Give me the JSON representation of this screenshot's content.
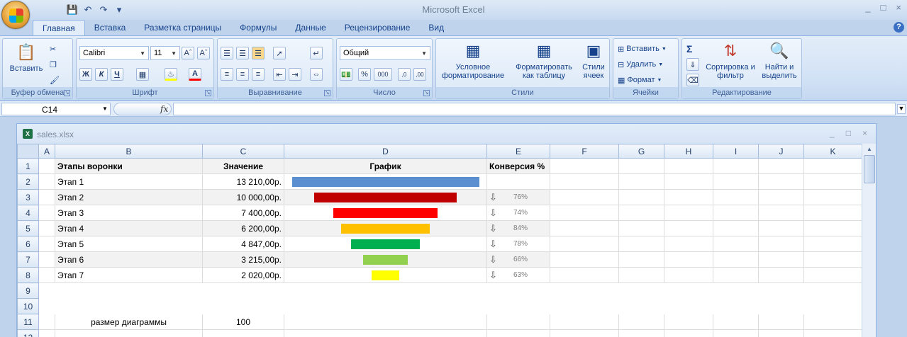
{
  "app": {
    "title": "Microsoft Excel",
    "window_controls": [
      "_",
      "□",
      "×"
    ]
  },
  "tabs": [
    {
      "label": "Главная",
      "active": true
    },
    {
      "label": "Вставка"
    },
    {
      "label": "Разметка страницы"
    },
    {
      "label": "Формулы"
    },
    {
      "label": "Данные"
    },
    {
      "label": "Рецензирование"
    },
    {
      "label": "Вид"
    }
  ],
  "ribbon": {
    "clipboard": {
      "label": "Буфер обмена",
      "paste": "Вставить"
    },
    "font": {
      "label": "Шрифт",
      "name": "Calibri",
      "size": "11",
      "bold": "Ж",
      "italic": "К",
      "underline": "Ч"
    },
    "alignment": {
      "label": "Выравнивание"
    },
    "number": {
      "label": "Число",
      "format": "Общий"
    },
    "styles": {
      "label": "Стили",
      "conditional": "Условное форматирование",
      "format_table": "Форматировать как таблицу",
      "cell_styles": "Стили ячеек"
    },
    "cells": {
      "label": "Ячейки",
      "insert": "Вставить",
      "delete": "Удалить",
      "format": "Формат"
    },
    "editing": {
      "label": "Редактирование",
      "sort": "Сортировка и фильтр",
      "find": "Найти и выделить"
    }
  },
  "formula_bar": {
    "name_box": "C14",
    "fx": "fx",
    "value": ""
  },
  "workbook": {
    "name": "sales.xlsx",
    "columns": [
      "A",
      "B",
      "C",
      "D",
      "E",
      "F",
      "G",
      "H",
      "I",
      "J",
      "K"
    ],
    "headers": {
      "stage": "Этапы воронки",
      "value": "Значение",
      "chart": "График",
      "conversion": "Конверсия %"
    },
    "rows": [
      {
        "stage": "Этап 1",
        "value": "13 210,00р.",
        "pct": 100,
        "color": "#5b8fd0",
        "conversion": ""
      },
      {
        "stage": "Этап 2",
        "value": "10 000,00р.",
        "pct": 76,
        "color": "#c00000",
        "conversion": "76%"
      },
      {
        "stage": "Этап 3",
        "value": "7 400,00р.",
        "pct": 56,
        "color": "#ff0000",
        "conversion": "74%"
      },
      {
        "stage": "Этап 4",
        "value": "6 200,00р.",
        "pct": 47,
        "color": "#ffc000",
        "conversion": "84%"
      },
      {
        "stage": "Этап 5",
        "value": "4 847,00р.",
        "pct": 37,
        "color": "#00b050",
        "conversion": "78%"
      },
      {
        "stage": "Этап 6",
        "value": "3 215,00р.",
        "pct": 24,
        "color": "#92d050",
        "conversion": "66%"
      },
      {
        "stage": "Этап 7",
        "value": "2 020,00р.",
        "pct": 15,
        "color": "#ffff00",
        "conversion": "63%"
      }
    ],
    "size_label": "размер диаграммы",
    "size_value": "100",
    "row_numbers": [
      "1",
      "2",
      "3",
      "4",
      "5",
      "6",
      "7",
      "8",
      "9",
      "10",
      "11",
      "12"
    ]
  }
}
